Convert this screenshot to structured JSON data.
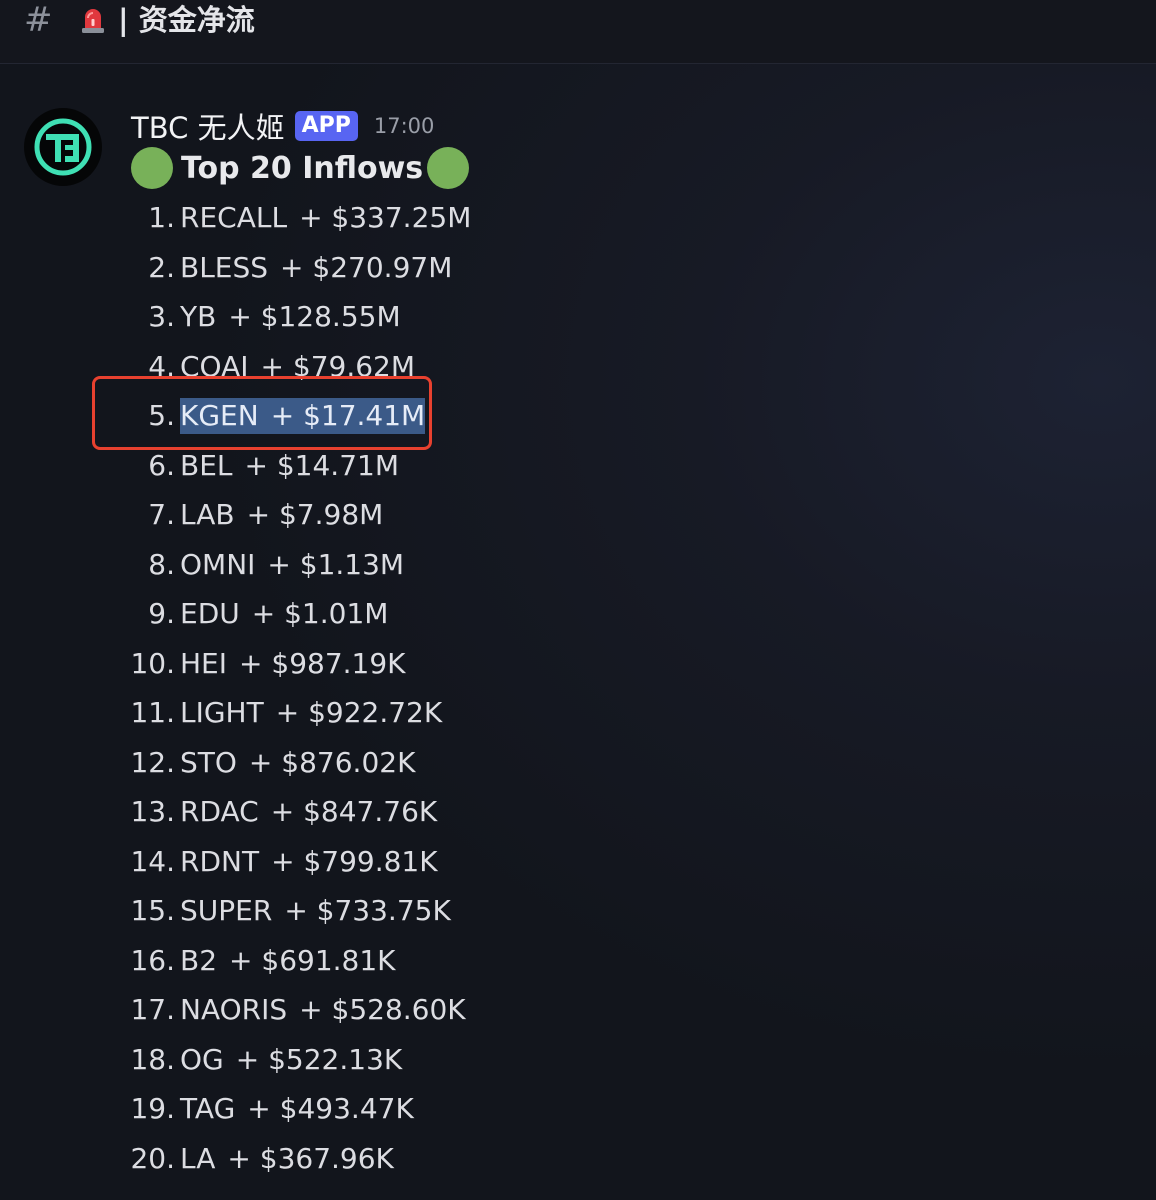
{
  "channel": {
    "icon": "hash-icon",
    "emoji": "siren-icon",
    "name": "| 资金净流"
  },
  "message": {
    "avatar": "tbc-logo-avatar",
    "author": "TBC 无人姬",
    "badge": "APP",
    "timestamp": "17:00",
    "title": "Top 20 Inflows",
    "title_emoji": "green-circle",
    "items": [
      {
        "rank": "1.",
        "symbol": "RECALL",
        "amount": "+ $337.25M"
      },
      {
        "rank": "2.",
        "symbol": "BLESS",
        "amount": "+ $270.97M"
      },
      {
        "rank": "3.",
        "symbol": "YB",
        "amount": "+ $128.55M"
      },
      {
        "rank": "4.",
        "symbol": "COAI",
        "amount": "+ $79.62M"
      },
      {
        "rank": "5.",
        "symbol": "KGEN",
        "amount": "+ $17.41M"
      },
      {
        "rank": "6.",
        "symbol": "BEL",
        "amount": "+ $14.71M"
      },
      {
        "rank": "7.",
        "symbol": "LAB",
        "amount": "+ $7.98M"
      },
      {
        "rank": "8.",
        "symbol": "OMNI",
        "amount": "+ $1.13M"
      },
      {
        "rank": "9.",
        "symbol": "EDU",
        "amount": "+ $1.01M"
      },
      {
        "rank": "10.",
        "symbol": "HEI",
        "amount": "+ $987.19K"
      },
      {
        "rank": "11.",
        "symbol": "LIGHT",
        "amount": "+ $922.72K"
      },
      {
        "rank": "12.",
        "symbol": "STO",
        "amount": "+ $876.02K"
      },
      {
        "rank": "13.",
        "symbol": "RDAC",
        "amount": "+ $847.76K"
      },
      {
        "rank": "14.",
        "symbol": "RDNT",
        "amount": "+ $799.81K"
      },
      {
        "rank": "15.",
        "symbol": "SUPER",
        "amount": "+ $733.75K"
      },
      {
        "rank": "16.",
        "symbol": "B2",
        "amount": "+ $691.81K"
      },
      {
        "rank": "17.",
        "symbol": "NAORIS",
        "amount": "+ $528.60K"
      },
      {
        "rank": "18.",
        "symbol": "OG",
        "amount": "+ $522.13K"
      },
      {
        "rank": "19.",
        "symbol": "TAG",
        "amount": "+ $493.47K"
      },
      {
        "rank": "20.",
        "symbol": "LA",
        "amount": "+ $367.96K"
      }
    ]
  },
  "colors": {
    "badge": "#5865f2",
    "green_circle": "#78b159",
    "highlight_box": "#e8412f",
    "selection": "#3b5a88"
  }
}
